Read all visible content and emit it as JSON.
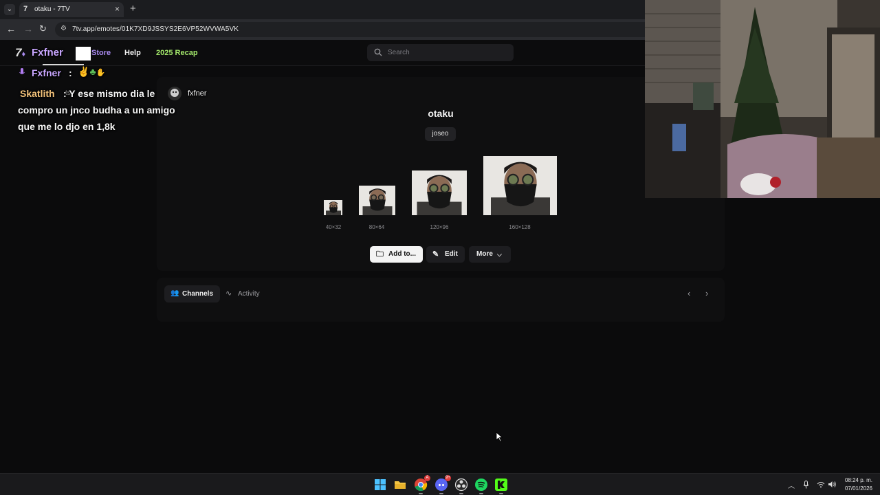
{
  "browser": {
    "tab_title": "otaku - 7TV",
    "url": "7tv.app/emotes/01K7XD9JSSYS2E6VP52WVWA5VK"
  },
  "site": {
    "logo_text": "Fxfner",
    "ghost_text": "ts",
    "nav": {
      "store": "Store",
      "help": "Help",
      "recap": "2025 Recap"
    },
    "search_placeholder": "Search"
  },
  "emote": {
    "name": "otaku",
    "owner": "joseo",
    "sizes": [
      "40×32",
      "80×64",
      "120×96",
      "160×128"
    ]
  },
  "actions": {
    "add": "Add to...",
    "edit": "Edit",
    "more": "More"
  },
  "tabs": {
    "channels": "Channels",
    "activity": "Activity"
  },
  "chat": {
    "msg1_user": "Fxfner",
    "separator": ":",
    "msg2_user": "Skatlith",
    "msg2_line1": ": Y ese mismo dia le",
    "msg2_tag": "fxfner",
    "msg2_line2": "compro un jnco budha a un amigo",
    "msg2_line3": "que me lo djo en 1,8k"
  },
  "taskbar": {
    "apps": [
      "windows-start",
      "file-explorer",
      "chrome",
      "discord",
      "obs",
      "spotify",
      "kick"
    ],
    "chrome_badge": "A",
    "discord_badge": "9+",
    "time": "08:24 p. m.",
    "date": "07/01/2026"
  },
  "colors": {
    "accent_store": "#a98af0",
    "accent_recap": "#a3e86b",
    "chat_user1": "#c9a6ff",
    "chat_user2": "#f3c27a"
  }
}
